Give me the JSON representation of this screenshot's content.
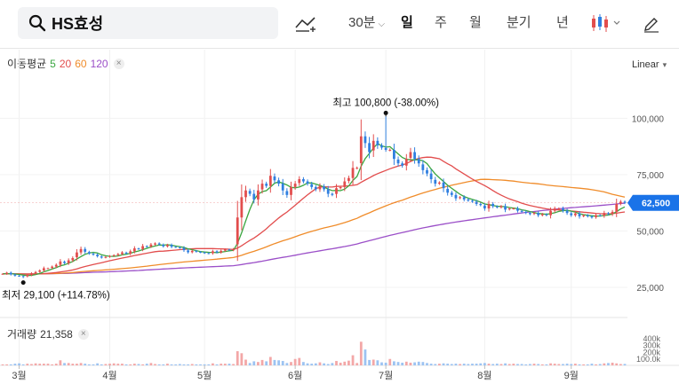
{
  "search": {
    "value": "HS효성"
  },
  "toolbar": {
    "intervals": [
      {
        "label": "30분",
        "active": false,
        "has_dropdown": true
      },
      {
        "label": "일",
        "active": true
      },
      {
        "label": "주",
        "active": false
      },
      {
        "label": "월",
        "active": false
      },
      {
        "label": "분기",
        "active": false
      },
      {
        "label": "년",
        "active": false
      }
    ],
    "icons": [
      "search-icon",
      "draw-trend-icon",
      "candle-type-icon",
      "pencil-icon"
    ]
  },
  "legend": {
    "ma_label": "이동평균",
    "ma_periods": [
      {
        "label": "5",
        "color": "#3aa640"
      },
      {
        "label": "20",
        "color": "#e24d4d"
      },
      {
        "label": "60",
        "color": "#f08c2a"
      },
      {
        "label": "120",
        "color": "#9b4fc8"
      }
    ],
    "scale_label": "Linear",
    "volume_label": "거래량",
    "volume_value": "21,358"
  },
  "chart_data": {
    "type": "candlestick",
    "title": "",
    "y_ticks": [
      "100,000",
      "75,000",
      "50,000",
      "25,000"
    ],
    "y_tick_values": [
      100000,
      75000,
      50000,
      25000
    ],
    "ylim": [
      14000,
      121000
    ],
    "x_tick_labels": [
      "3월",
      "4월",
      "5월",
      "6월",
      "7월",
      "8월",
      "9월"
    ],
    "x_tick_index": [
      4,
      26,
      49,
      71,
      93,
      117,
      138
    ],
    "current_price_label": "62,500",
    "current_price": 62500,
    "high_annotation": {
      "label": "최고 100,800 (-38.00%)",
      "value": 100800,
      "index": 93
    },
    "low_annotation": {
      "label": "최저 29,100 (+114.78%)",
      "value": 29100,
      "index": 5
    },
    "volume_ticks": [
      "400k",
      "300k",
      "200k",
      "100.0k"
    ],
    "volume_tick_values": [
      400000,
      300000,
      200000,
      100000
    ],
    "colors": {
      "up": "#e24d4d",
      "down": "#2f7fe0",
      "accent": "#1a73e8"
    },
    "closes": [
      31000,
      31500,
      30800,
      30200,
      30000,
      29800,
      30500,
      31200,
      31800,
      32500,
      33500,
      33500,
      34200,
      35000,
      36500,
      35800,
      37000,
      38000,
      40500,
      42000,
      40800,
      40000,
      39500,
      38800,
      38200,
      38500,
      38900,
      39300,
      39800,
      40500,
      40000,
      41000,
      42300,
      42000,
      43300,
      43000,
      44000,
      44500,
      44000,
      43200,
      43800,
      43000,
      42800,
      42500,
      41500,
      40600,
      41200,
      40800,
      40500,
      40200,
      40000,
      41000,
      40500,
      41200,
      41800,
      41500,
      42000,
      56000,
      65000,
      68000,
      66500,
      64000,
      68000,
      71000,
      70000,
      74500,
      72500,
      71000,
      68000,
      66000,
      69500,
      71000,
      73000,
      72000,
      71000,
      69500,
      68500,
      70000,
      68500,
      66500,
      66000,
      69000,
      69500,
      72000,
      73500,
      78000,
      78000,
      92000,
      89000,
      85000,
      90000,
      88000,
      87000,
      86000,
      86000,
      82000,
      80000,
      79000,
      82000,
      85000,
      82000,
      80000,
      77000,
      75500,
      73000,
      71000,
      71500,
      69000,
      67000,
      66000,
      64500,
      65000,
      64000,
      63500,
      63000,
      62000,
      61500,
      60000,
      62000,
      61000,
      60500,
      61000,
      59500,
      60000,
      60000,
      59000,
      58500,
      58000,
      57500,
      58000,
      57000,
      57500,
      57000,
      59000,
      60000,
      60000,
      59000,
      58000,
      57000,
      57800,
      56500,
      57000,
      56500,
      56000,
      57000,
      56800,
      58000,
      57500,
      58500,
      62000,
      63000,
      62500
    ],
    "volumes": [
      15000,
      15000,
      15000,
      25000,
      30000,
      15000,
      25000,
      20000,
      30000,
      25000,
      25000,
      25000,
      15000,
      25000,
      75000,
      35000,
      35000,
      25000,
      25000,
      35000,
      25000,
      15000,
      15000,
      30000,
      15000,
      20000,
      25000,
      30000,
      25000,
      25000,
      15000,
      15000,
      25000,
      20000,
      15000,
      25000,
      35000,
      20000,
      15000,
      15000,
      25000,
      15000,
      15000,
      20000,
      15000,
      15000,
      20000,
      15000,
      15000,
      15000,
      15000,
      30000,
      15000,
      25000,
      25000,
      25000,
      20000,
      210000,
      180000,
      85000,
      35000,
      60000,
      50000,
      80000,
      60000,
      125000,
      80000,
      75000,
      65000,
      35000,
      50000,
      95000,
      110000,
      50000,
      30000,
      25000,
      30000,
      45000,
      30000,
      20000,
      35000,
      65000,
      40000,
      55000,
      70000,
      150000,
      35000,
      350000,
      235000,
      80000,
      85000,
      75000,
      45000,
      40000,
      95000,
      60000,
      50000,
      40000,
      55000,
      40000,
      45000,
      55000,
      50000,
      35000,
      25000,
      20000,
      25000,
      30000,
      25000,
      20000,
      25000,
      20000,
      25000,
      20000,
      25000,
      25000,
      30000,
      35000,
      25000,
      20000,
      25000,
      20000,
      30000,
      20000,
      25000,
      20000,
      20000,
      15000,
      20000,
      25000,
      20000,
      15000,
      15000,
      30000,
      25000,
      20000,
      20000,
      25000,
      20000,
      25000,
      15000,
      15000,
      15000,
      25000,
      15000,
      20000,
      30000,
      35000,
      40000,
      30000,
      20000,
      21358
    ]
  }
}
